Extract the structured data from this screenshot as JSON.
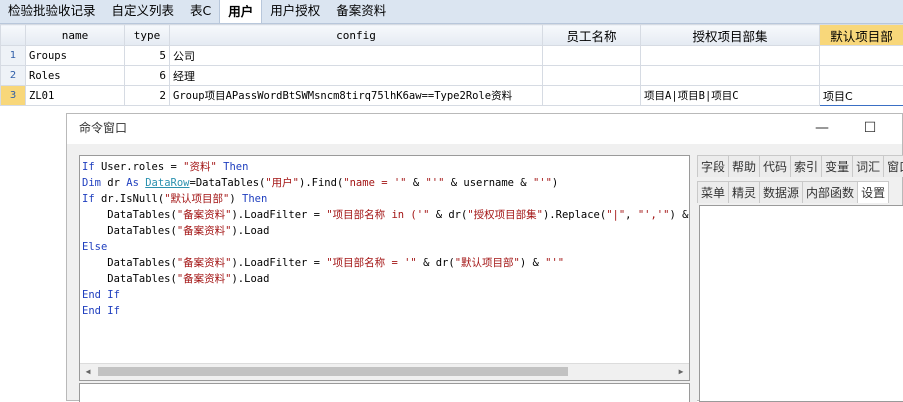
{
  "tabs": [
    "检验批验收记录",
    "自定义列表",
    "表C",
    "用户",
    "用户授权",
    "备案资料"
  ],
  "active_tab": "用户",
  "grid": {
    "columns": [
      "name",
      "type",
      "config",
      "员工名称",
      "授权项目部集",
      "默认项目部"
    ],
    "rows": [
      {
        "num": "1",
        "name": "Groups",
        "type": "5",
        "config": "公司",
        "employee": "",
        "auth": "",
        "default": ""
      },
      {
        "num": "2",
        "name": "Roles",
        "type": "6",
        "config": "经理",
        "employee": "",
        "auth": "",
        "default": ""
      },
      {
        "num": "3",
        "name": "ZL01",
        "type": "2",
        "config": "Group项目APassWordBtSWMsncm8tirq75lhK6aw==Type2Role资料",
        "employee": "",
        "auth": "项目A|项目B|项目C",
        "default": "项目C"
      }
    ]
  },
  "command_window": {
    "title": "命令窗口",
    "minimize_glyph": "—",
    "maximize_glyph": "☐",
    "code_lines": [
      [
        [
          "kw",
          "If "
        ],
        [
          "",
          "User.roles = "
        ],
        [
          "str",
          "\"资料\""
        ],
        [
          "kw",
          " Then"
        ]
      ],
      [
        [
          "kw",
          "Dim "
        ],
        [
          "",
          "dr "
        ],
        [
          "kw",
          "As "
        ],
        [
          "typ",
          "DataRow"
        ],
        [
          "",
          "=DataTables("
        ],
        [
          "str",
          "\"用户\""
        ],
        [
          "",
          ").Find("
        ],
        [
          "str",
          "\"name = '\""
        ],
        [
          "",
          " & "
        ],
        [
          "str",
          "\"'\""
        ],
        [
          "",
          " & username & "
        ],
        [
          "str",
          "\"'\""
        ],
        [
          "",
          ")"
        ]
      ],
      [
        [
          "kw",
          "If "
        ],
        [
          "",
          "dr.IsNull("
        ],
        [
          "str",
          "\"默认项目部\""
        ],
        [
          "",
          ") "
        ],
        [
          "kw",
          "Then"
        ]
      ],
      [
        [
          "",
          "    DataTables("
        ],
        [
          "str",
          "\"备案资料\""
        ],
        [
          "",
          ").LoadFilter = "
        ],
        [
          "str",
          "\"项目部名称 in ('\""
        ],
        [
          "",
          " & dr("
        ],
        [
          "str",
          "\"授权项目部集\""
        ],
        [
          "",
          ").Replace("
        ],
        [
          "str",
          "\"|\""
        ],
        [
          "",
          ", "
        ],
        [
          "str",
          "\"','\""
        ],
        [
          "",
          ") & "
        ]
      ],
      [
        [
          "",
          "    DataTables("
        ],
        [
          "str",
          "\"备案资料\""
        ],
        [
          "",
          ").Load"
        ]
      ],
      [
        [
          "kw",
          "Else"
        ]
      ],
      [
        [
          "",
          "    DataTables("
        ],
        [
          "str",
          "\"备案资料\""
        ],
        [
          "",
          ").LoadFilter = "
        ],
        [
          "str",
          "\"项目部名称 = '\""
        ],
        [
          "",
          " & dr("
        ],
        [
          "str",
          "\"默认项目部\""
        ],
        [
          "",
          ") & "
        ],
        [
          "str",
          "\"'\""
        ]
      ],
      [
        [
          "",
          "    DataTables("
        ],
        [
          "str",
          "\"备案资料\""
        ],
        [
          "",
          ").Load"
        ]
      ],
      [
        [
          "kw",
          "End If"
        ]
      ],
      [
        [
          "kw",
          "End If"
        ]
      ]
    ],
    "panel_tabs_row1": [
      "字段",
      "帮助",
      "代码",
      "索引",
      "变量",
      "词汇",
      "窗口"
    ],
    "panel_tabs_row2": [
      "菜单",
      "精灵",
      "数据源",
      "内部函数",
      "设置"
    ],
    "active_panel_tab": "设置"
  }
}
